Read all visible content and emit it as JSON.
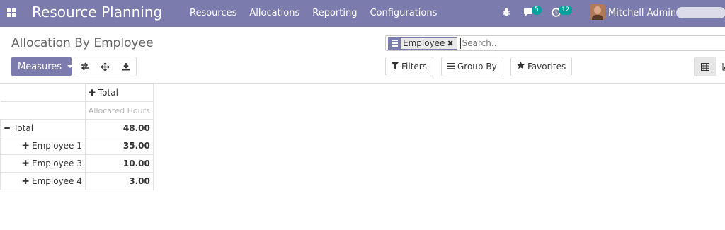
{
  "navbar": {
    "app_title": "Resource Planning",
    "menu": [
      "Resources",
      "Allocations",
      "Reporting",
      "Configurations"
    ],
    "messages_badge": "5",
    "activities_badge": "12",
    "user_name": "Mitchell Admin"
  },
  "control_panel": {
    "title": "Allocation By Employee",
    "measures_label": "Measures",
    "search": {
      "facet_label": "Employee",
      "placeholder": "Search..."
    },
    "filters_label": "Filters",
    "group_by_label": "Group By",
    "favorites_label": "Favorites"
  },
  "pivot": {
    "col_header": "Total",
    "measure_header": "Allocated Hours",
    "total_row": {
      "label": "Total",
      "value": "48.00"
    },
    "rows": [
      {
        "label": "Employee 1",
        "value": "35.00"
      },
      {
        "label": "Employee 3",
        "value": "10.00"
      },
      {
        "label": "Employee 4",
        "value": "3.00"
      }
    ]
  },
  "colors": {
    "brand": "#7c7bad",
    "badge": "#00a09d"
  }
}
